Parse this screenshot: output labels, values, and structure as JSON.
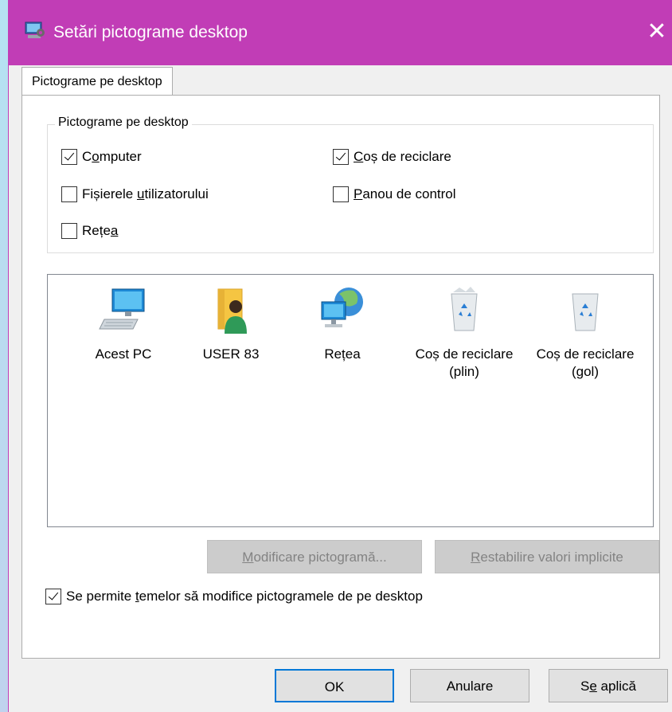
{
  "window": {
    "title": "Setări pictograme desktop",
    "close_symbol": "✕",
    "accent_color": "#c13db6"
  },
  "tabs": [
    {
      "label": "Pictograme pe desktop",
      "active": true
    }
  ],
  "group": {
    "legend": "Pictograme pe desktop",
    "checkboxes": [
      {
        "label": "Computer",
        "checked": true
      },
      {
        "label": "Coș de reciclare",
        "checked": true
      },
      {
        "label": "Fișierele utilizatorului",
        "checked": false
      },
      {
        "label": "Panou de control",
        "checked": false
      },
      {
        "label": "Rețea",
        "checked": false
      }
    ]
  },
  "icons": [
    {
      "label": "Acest PC",
      "icon": "computer-icon"
    },
    {
      "label": "USER 83",
      "icon": "user-folder-icon"
    },
    {
      "label": "Rețea",
      "icon": "network-icon"
    },
    {
      "label": "Coș de reciclare (plin)",
      "icon": "recycle-bin-full-icon"
    },
    {
      "label": "Coș de reciclare (gol)",
      "icon": "recycle-bin-empty-icon"
    }
  ],
  "buttons": {
    "change_icon": "Modificare pictogramă...",
    "restore_defaults": "Restabilire valori implicite",
    "ok": "OK",
    "cancel": "Anulare",
    "apply": "Se aplică"
  },
  "allow_themes": {
    "label": "Se permite temelor să modifice pictogramele de pe desktop",
    "checked": true
  }
}
